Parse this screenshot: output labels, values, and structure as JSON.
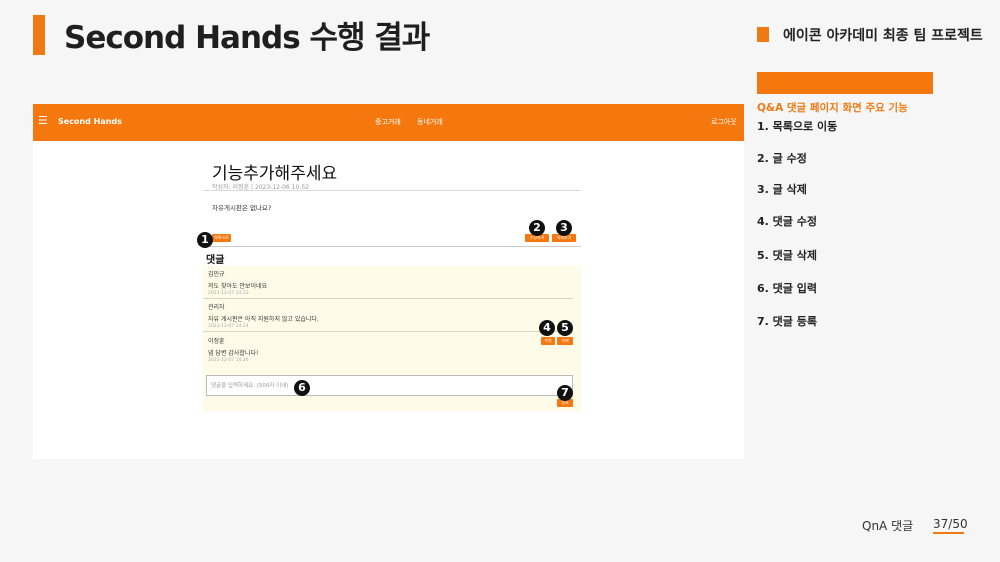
{
  "slide": {
    "title": "Second Hands 수행 결과",
    "project_label": "에이콘 아카데미 최종 팀 프로젝트",
    "footer_label": "QnA 댓글",
    "page_number": "37/50"
  },
  "sidebar": {
    "heading": "Q&A 댓글 페이지 화면 주요 기능",
    "features": [
      "1. 목록으로 이동",
      "2. 글 수정",
      "3. 글 삭제",
      "4. 댓글 수정",
      "5. 댓글 삭제",
      "6. 댓글 입력",
      "7. 댓글 등록"
    ]
  },
  "app": {
    "navbar": {
      "menu_icon": "menu-icon",
      "brand": "Second Hands",
      "links": [
        "중고거래",
        "동네거래"
      ],
      "logout": "로그아웃"
    },
    "post": {
      "title": "기능추가해주세요",
      "meta": "작성자: 이정훈 | 2023-12-06 10:52",
      "body": "자유게시판은 없나요?",
      "list_button": "목록으로",
      "edit_button": "수정하기",
      "delete_button": "삭제하기"
    },
    "comments_heading": "댓글",
    "comments": [
      {
        "author": "김민규",
        "text": "저도 찾아도 안보이네요",
        "date": "2023-12-07 14:23"
      },
      {
        "author": "관리자",
        "text": "자유 게시판은 아직 지원하지 않고 있습니다.",
        "date": "2023-12-07 14:24"
      },
      {
        "author": "이정훈",
        "text": "넵 답변 감사합니다!",
        "date": "2023-12-07 14:26"
      }
    ],
    "comment_edit_button": "수정",
    "comment_delete_button": "삭제",
    "comment_input_placeholder": "댓글을 입력하세요. (500자 이내)",
    "comment_submit_button": "등록"
  },
  "markers": [
    "1",
    "2",
    "3",
    "4",
    "5",
    "6",
    "7"
  ],
  "colors": {
    "accent": "#f5780f",
    "title_text": "#1f1f1f"
  }
}
